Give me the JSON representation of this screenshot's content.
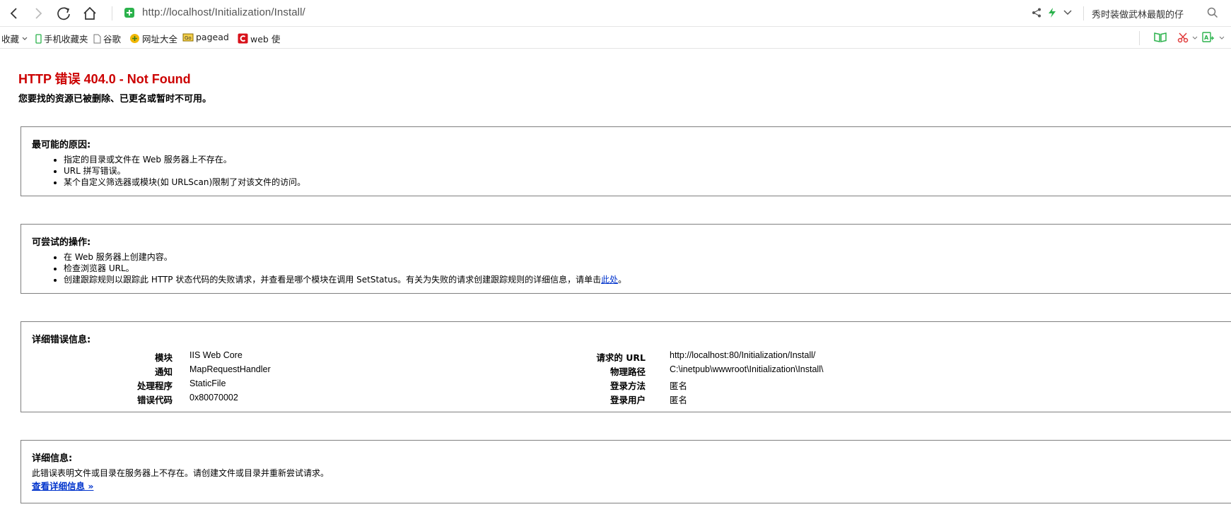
{
  "browser": {
    "url": "http://localhost/Initialization/Install/",
    "search_text": "秀时装做武林最靓的仔",
    "bookmarks": [
      {
        "label": "收藏",
        "icon": "chevron-down-icon"
      },
      {
        "label": "手机收藏夹",
        "icon": "phone-icon"
      },
      {
        "label": "谷歌",
        "icon": "page-icon"
      },
      {
        "label": "网址大全",
        "icon": "globe-icon"
      },
      {
        "label": "pagead",
        "icon": "ad-icon"
      },
      {
        "label": "web 使",
        "icon": "c-logo-icon"
      }
    ]
  },
  "page": {
    "title": "HTTP 错误 404.0 - Not Found",
    "subtitle": "您要找的资源已被删除、已更名或暂时不可用。",
    "causes": {
      "heading": "最可能的原因:",
      "items": [
        "指定的目录或文件在 Web 服务器上不存在。",
        "URL 拼写错误。",
        "某个自定义筛选器或模块(如 URLScan)限制了对该文件的访问。"
      ]
    },
    "actions": {
      "heading": "可尝试的操作:",
      "items": [
        "在 Web 服务器上创建内容。",
        "检查浏览器 URL。"
      ],
      "last_item_prefix": "创建跟踪规则以跟踪此 HTTP 状态代码的失败请求，并查看是哪个模块在调用 SetStatus。有关为失败的请求创建跟踪规则的详细信息，请单击",
      "last_item_link": "此处",
      "last_item_suffix": "。"
    },
    "details": {
      "heading": "详细错误信息:",
      "left": [
        {
          "label": "模块",
          "value": "IIS Web Core"
        },
        {
          "label": "通知",
          "value": "MapRequestHandler"
        },
        {
          "label": "处理程序",
          "value": "StaticFile"
        },
        {
          "label": "错误代码",
          "value": "0x80070002"
        }
      ],
      "right": [
        {
          "label": "请求的 URL",
          "value": "http://localhost:80/Initialization/Install/"
        },
        {
          "label": "物理路径",
          "value": "C:\\inetpub\\wwwroot\\Initialization\\Install\\"
        },
        {
          "label": "登录方法",
          "value": "匿名"
        },
        {
          "label": "登录用户",
          "value": "匿名"
        }
      ]
    },
    "more": {
      "heading": "详细信息:",
      "text": "此错误表明文件或目录在服务器上不存在。请创建文件或目录并重新尝试请求。",
      "link": "查看详细信息 »"
    }
  },
  "colors": {
    "title_red": "#cc0000",
    "link_blue": "#0033cc",
    "box_border": "#7f7f7f",
    "shield_green": "#2bb24c"
  }
}
